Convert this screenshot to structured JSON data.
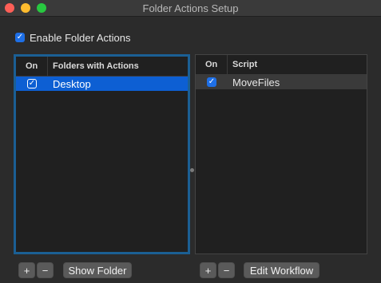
{
  "window": {
    "title": "Folder Actions Setup"
  },
  "enable": {
    "label": "Enable Folder Actions",
    "checked": true
  },
  "folders_table": {
    "col_on": "On",
    "col_name": "Folders with Actions",
    "rows": [
      {
        "on": true,
        "name": "Desktop"
      }
    ]
  },
  "scripts_table": {
    "col_on": "On",
    "col_name": "Script",
    "rows": [
      {
        "on": true,
        "name": "MoveFiles"
      }
    ]
  },
  "buttons": {
    "plus": "+",
    "minus": "−",
    "show_folder": "Show Folder",
    "edit_workflow": "Edit Workflow"
  },
  "check_glyph": "✓"
}
